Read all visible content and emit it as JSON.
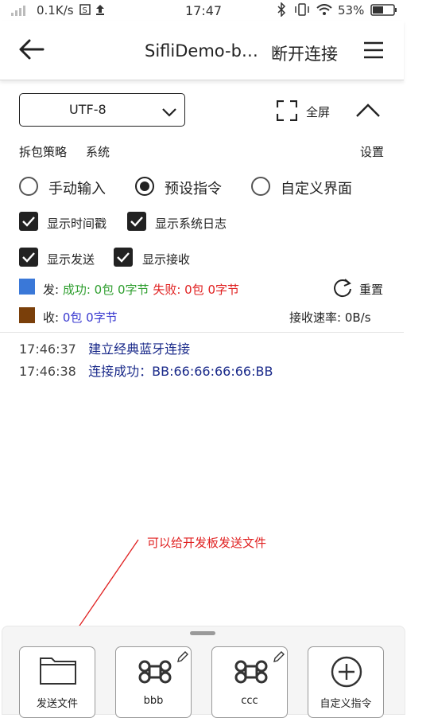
{
  "status_bar": {
    "network_speed": "0.1K/s",
    "time": "17:47",
    "battery": "53%"
  },
  "header": {
    "title": "SifliDemo-b…",
    "disconnect_label": "断开连接"
  },
  "encoding": {
    "value": "UTF-8"
  },
  "fullscreen": {
    "label": "全屏"
  },
  "unpack": {
    "label": "拆包策略",
    "value": "系统",
    "settings_label": "设置"
  },
  "input_modes": [
    {
      "label": "手动输入",
      "selected": false
    },
    {
      "label": "预设指令",
      "selected": true
    },
    {
      "label": "自定义界面",
      "selected": false
    }
  ],
  "checkboxes": [
    {
      "label": "显示时间戳",
      "checked": true
    },
    {
      "label": "显示系统日志",
      "checked": true
    },
    {
      "label": "显示发送",
      "checked": true
    },
    {
      "label": "显示接收",
      "checked": true
    }
  ],
  "send_stats": {
    "prefix": "发:",
    "success": "成功: 0包 0字节",
    "fail": "失败: 0包 0字节",
    "color": "#3a78d8"
  },
  "recv_stats": {
    "prefix": "收:",
    "value": "0包 0字节",
    "color": "#7a3f0a"
  },
  "reset": {
    "label": "重置"
  },
  "rate": {
    "label": "接收速率:",
    "value": "0B/s"
  },
  "log": [
    {
      "time": "17:46:37",
      "message": "建立经典蓝牙连接"
    },
    {
      "time": "17:46:38",
      "message": "连接成功：BB:66:66:66:66:BB"
    }
  ],
  "annotation": {
    "text": "可以给开发板发送文件"
  },
  "commands": [
    {
      "label": "发送文件",
      "icon": "folder-icon"
    },
    {
      "label": "bbb",
      "icon": "command-icon"
    },
    {
      "label": "ccc",
      "icon": "command-icon"
    },
    {
      "label": "自定义指令",
      "icon": "plus-circle-icon"
    }
  ]
}
